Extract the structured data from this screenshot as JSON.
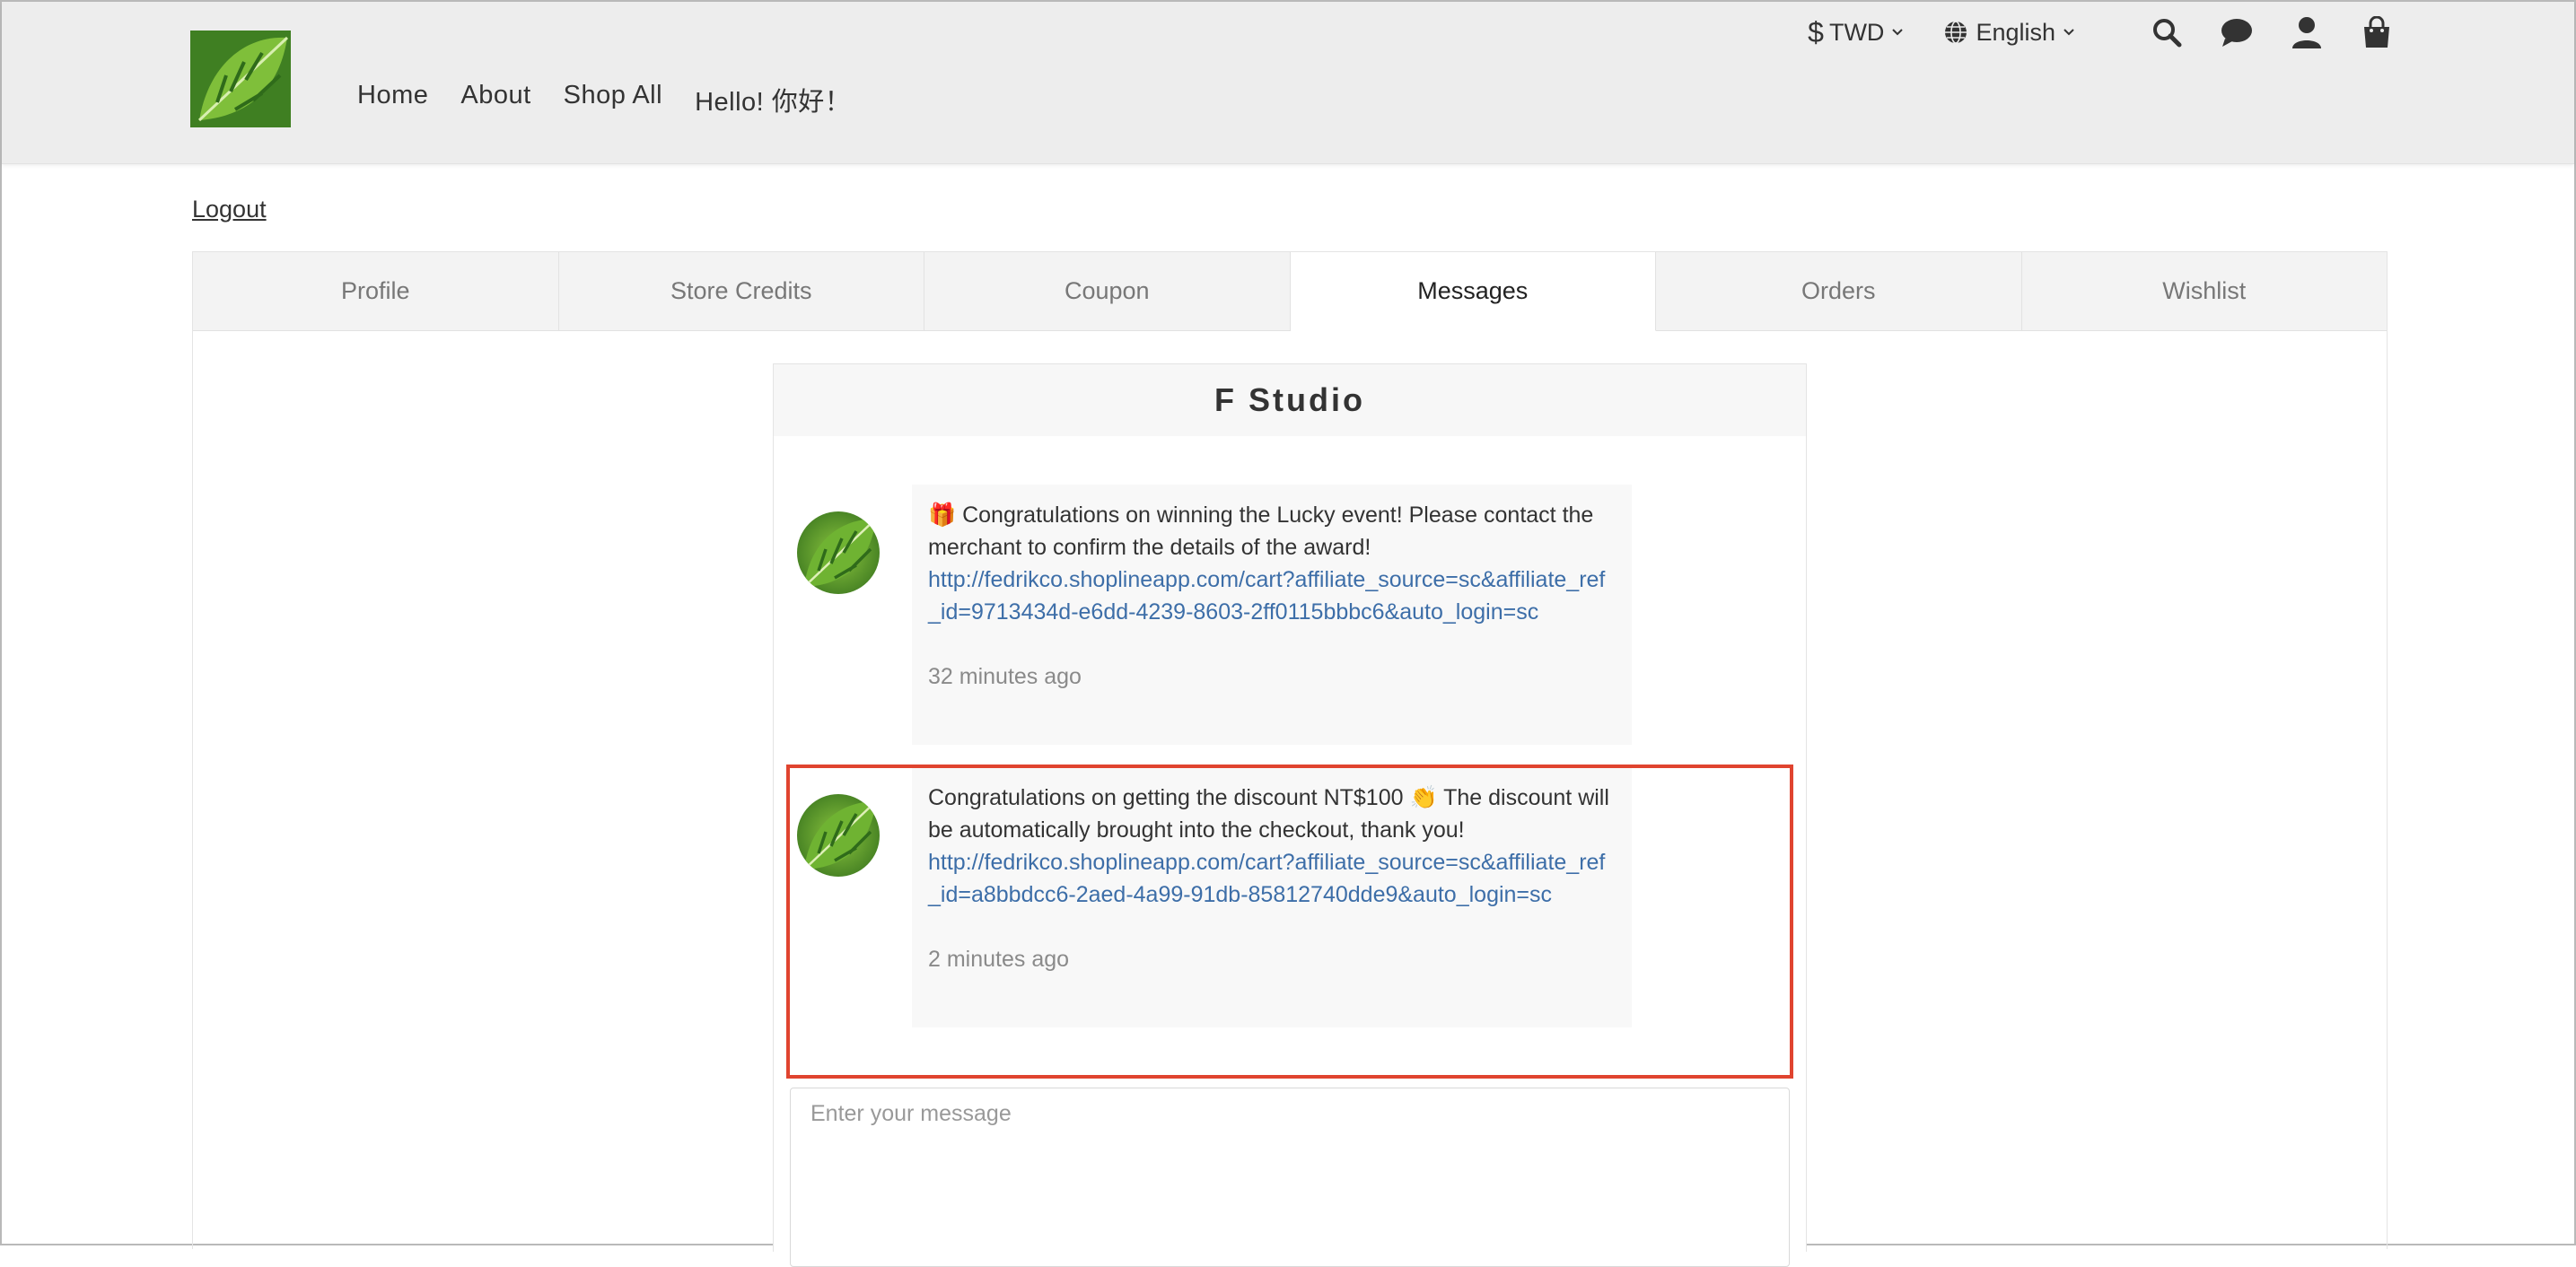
{
  "header": {
    "nav": [
      "Home",
      "About",
      "Shop All",
      "Hello! 你好！"
    ],
    "currency": "TWD",
    "language": "English",
    "icons": [
      "dollar-icon",
      "globe-icon",
      "search-icon",
      "chat-icon",
      "user-icon",
      "bag-icon"
    ]
  },
  "account": {
    "logout_label": "Logout",
    "tabs": [
      "Profile",
      "Store Credits",
      "Coupon",
      "Messages",
      "Orders",
      "Wishlist"
    ],
    "active_tab": "Messages"
  },
  "chat": {
    "title": "F Studio",
    "messages": [
      {
        "emoji": "🎁",
        "text": "Congratulations on winning the Lucky  event! Please contact the merchant to confirm the details of the award!",
        "link": "http://fedrikco.shoplineapp.com/cart?affiliate_source=sc&affiliate_ref_id=9713434d-e6dd-4239-8603-2ff0115bbbc6&auto_login=sc",
        "time": "32 minutes ago"
      },
      {
        "text_before": "Congratulations on getting the discount NT$100 ",
        "emoji": "👏",
        "text_after": " The discount will be automatically brought into the checkout, thank you!",
        "link": "http://fedrikco.shoplineapp.com/cart?affiliate_source=sc&affiliate_ref_id=a8bbdcc6-2aed-4a99-91db-85812740dde9&auto_login=sc",
        "time": "2 minutes ago"
      }
    ],
    "input_placeholder": "Enter your message"
  },
  "colors": {
    "header_bg": "#ededed",
    "link": "#3d6ea8",
    "highlight": "#e0442f"
  }
}
